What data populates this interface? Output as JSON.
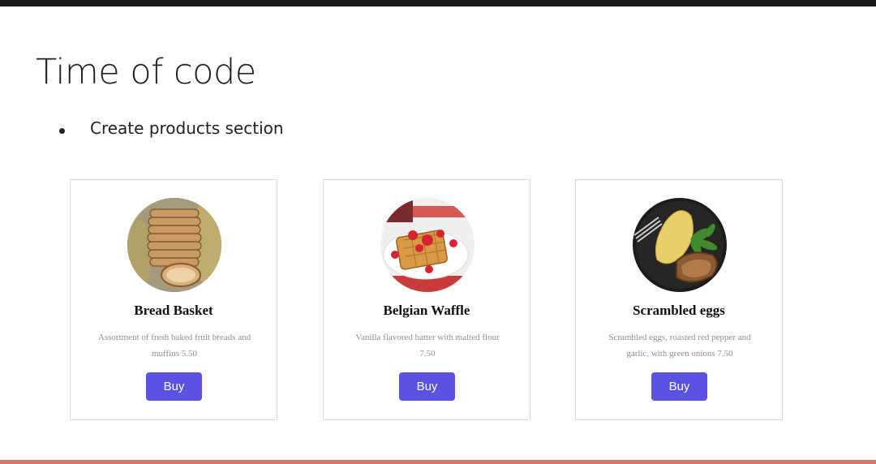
{
  "slide": {
    "title": "Time of code",
    "bullets": [
      "Create products section"
    ]
  },
  "products": [
    {
      "name": "Bread Basket",
      "description": "Assortment of fresh baked fruit breads and muffins 5.50",
      "button_label": "Buy",
      "image_icon": "bread-image"
    },
    {
      "name": "Belgian Waffle",
      "description": "Vanilla flavored batter with malted flour 7.50",
      "button_label": "Buy",
      "image_icon": "waffle-image"
    },
    {
      "name": "Scrambled eggs",
      "description": "Scrambled eggs, roasted red pepper and garlic, with green onions 7.50",
      "button_label": "Buy",
      "image_icon": "eggs-image"
    }
  ],
  "colors": {
    "button": "#5a52e0",
    "accent_bar": "#d4776a",
    "top_bar": "#1b1b1b"
  }
}
